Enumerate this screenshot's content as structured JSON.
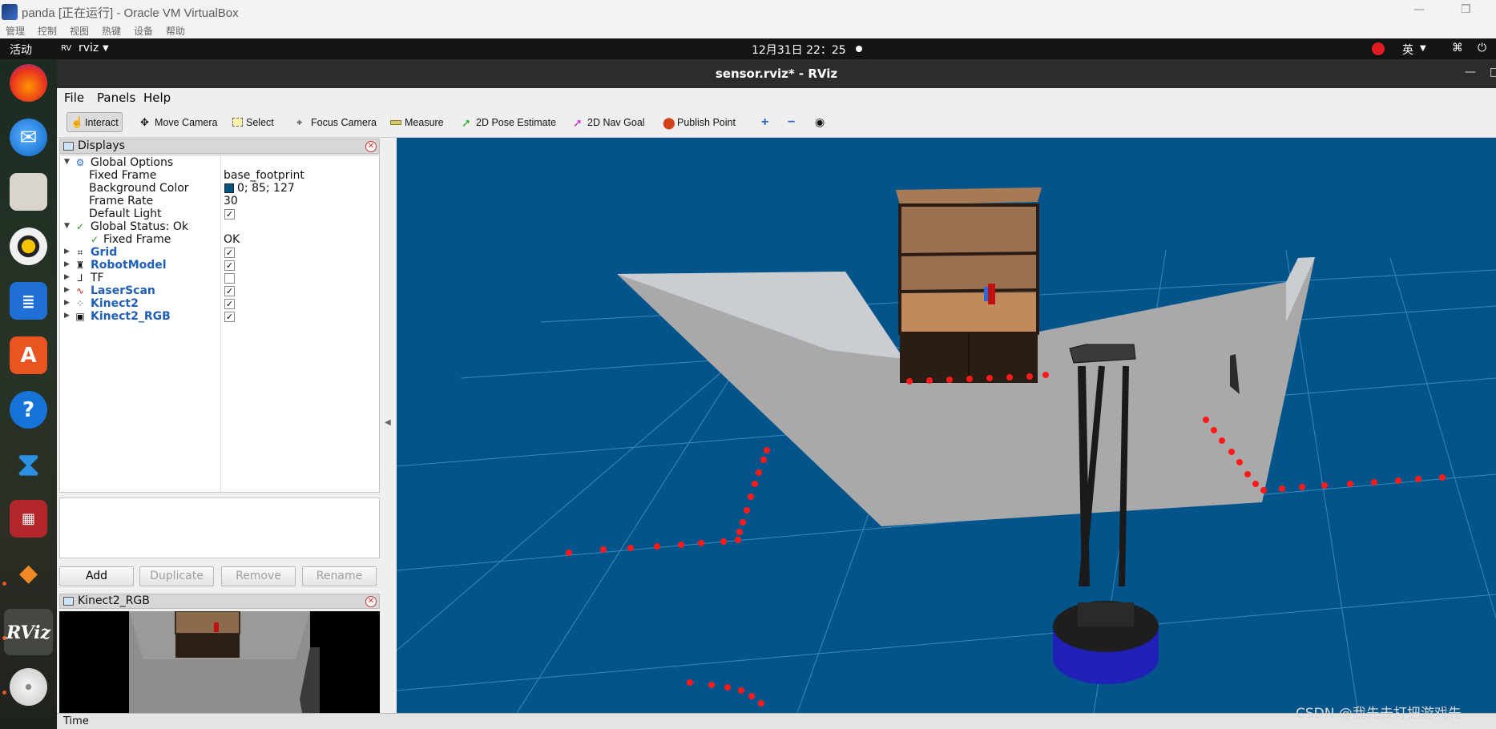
{
  "vbox": {
    "title": "panda [正在运行] - Oracle VM VirtualBox",
    "menu": [
      "管理",
      "控制",
      "视图",
      "热键",
      "设备",
      "帮助"
    ]
  },
  "topbar": {
    "activities": "活动",
    "app_name": "rviz",
    "clock": "12月31日  22：25",
    "input_method": "英"
  },
  "dock": {
    "items": [
      "firefox-icon",
      "thunderbird-icon",
      "files-icon",
      "rhythmbox-icon",
      "writer-icon",
      "app-center-icon",
      "help-icon",
      "vscode-icon",
      "terminal-app-icon",
      "layers-app-icon",
      "rviz-icon",
      "disc-icon"
    ]
  },
  "window": {
    "title": "sensor.rviz* - RViz"
  },
  "menubar": {
    "file": "File",
    "panels": "Panels",
    "help": "Help"
  },
  "toolbar": {
    "interact": "Interact",
    "move_camera": "Move Camera",
    "select": "Select",
    "focus_camera": "Focus Camera",
    "measure": "Measure",
    "pose_estimate": "2D Pose Estimate",
    "nav_goal": "2D Nav Goal",
    "publish_point": "Publish Point"
  },
  "displays": {
    "title": "Displays",
    "global_options": "Global Options",
    "fixed_frame_label": "Fixed Frame",
    "fixed_frame_value": "base_footprint",
    "bg_color_label": "Background Color",
    "bg_color_value": "0; 85; 127",
    "bg_color_hex": "#00557f",
    "frame_rate_label": "Frame Rate",
    "frame_rate_value": "30",
    "default_light_label": "Default Light",
    "global_status": "Global Status: Ok",
    "status_fixed_frame": "Fixed Frame",
    "status_fixed_frame_value": "OK",
    "items": [
      {
        "name": "Grid",
        "checked": true
      },
      {
        "name": "RobotModel",
        "checked": true
      },
      {
        "name": "TF",
        "checked": false
      },
      {
        "name": "LaserScan",
        "checked": true
      },
      {
        "name": "Kinect2",
        "checked": true
      },
      {
        "name": "Kinect2_RGB",
        "checked": true
      }
    ]
  },
  "buttons": {
    "add": "Add",
    "duplicate": "Duplicate",
    "remove": "Remove",
    "rename": "Rename"
  },
  "camera_panel": {
    "title": "Kinect2_RGB"
  },
  "time_panel": {
    "title": "Time"
  },
  "watermark": "CSDN @我先去打把游戏先"
}
